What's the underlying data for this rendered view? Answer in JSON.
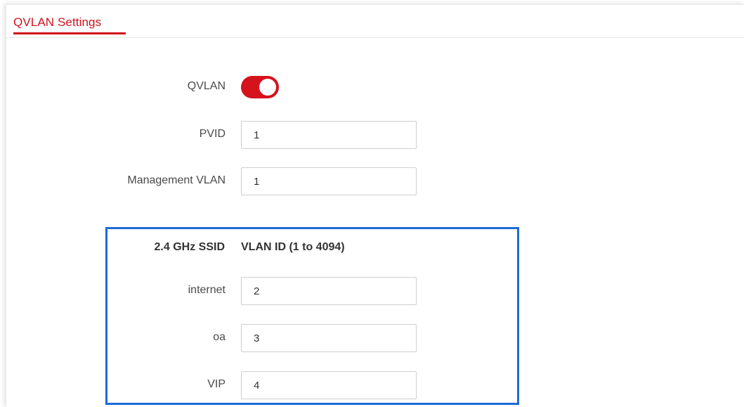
{
  "header": {
    "title": "QVLAN Settings"
  },
  "qvlan": {
    "label": "QVLAN",
    "enabled": true
  },
  "pvid": {
    "label": "PVID",
    "value": "1"
  },
  "management_vlan": {
    "label": "Management VLAN",
    "value": "1"
  },
  "ssid_table": {
    "col_ssid": "2.4 GHz SSID",
    "col_vlan": "VLAN ID (1 to 4094)",
    "rows": [
      {
        "ssid": "internet",
        "vlan_id": "2"
      },
      {
        "ssid": "oa",
        "vlan_id": "3"
      },
      {
        "ssid": "VIP",
        "vlan_id": "4"
      }
    ]
  },
  "colors": {
    "accent_red": "#d0121c",
    "highlight_blue": "#1e6ad6"
  }
}
